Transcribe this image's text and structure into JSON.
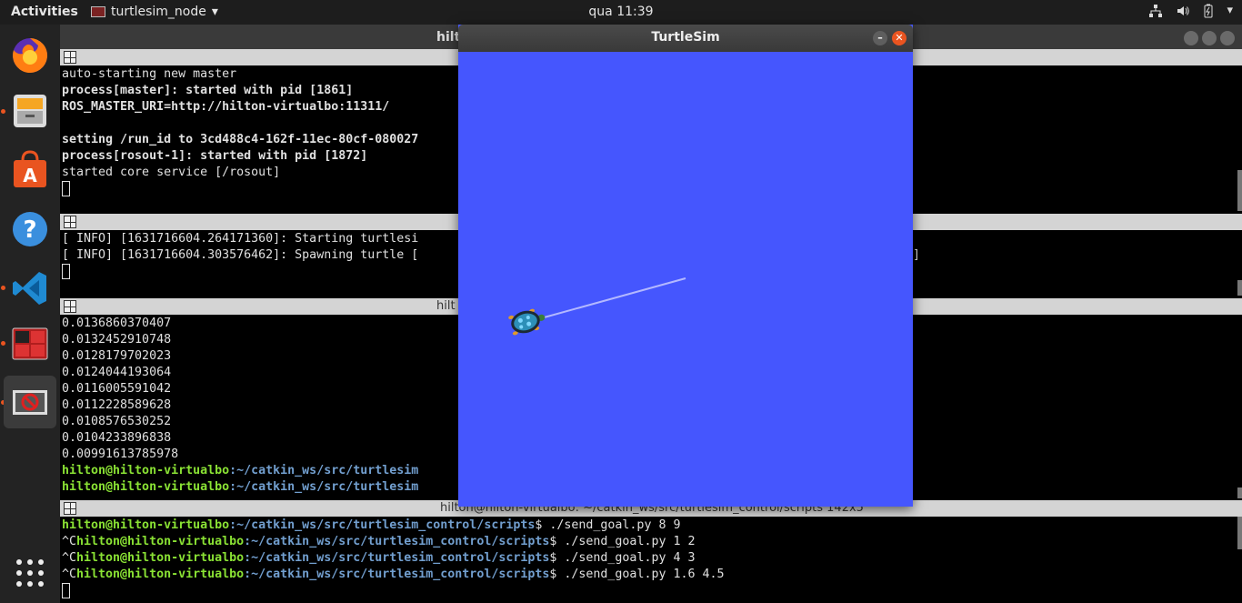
{
  "topbar": {
    "activities": "Activities",
    "app_name": "turtlesim_node",
    "clock": "qua 11:39"
  },
  "dock": {
    "items": [
      "firefox-icon",
      "files-icon",
      "software-center-icon",
      "help-icon",
      "vscode-icon",
      "terminator-icon",
      "turtlesim-app-icon",
      "show-applications-icon"
    ]
  },
  "terminal": {
    "window_title": "hilt",
    "pane1": {
      "lines": [
        "auto-starting new master",
        "process[master]: started with pid [1861]",
        "ROS_MASTER_URI=http://hilton-virtualbo:11311/",
        "",
        "setting /run_id to 3cd488c4-162f-11ec-80cf-080027",
        "process[rosout-1]: started with pid [1872]",
        "started core service [/rosout]"
      ]
    },
    "pane2": {
      "lines": [
        "[ INFO] [1631716604.264171360]: Starting turtlesi",
        "[ INFO] [1631716604.303576462]: Spawning turtle ["
      ],
      "trailing": "]"
    },
    "pane3": {
      "title": "hilt",
      "values": [
        "0.0136860370407",
        "0.0132452910748",
        "0.0128179702023",
        "0.0124044193064",
        "0.0116005591042",
        "0.0112228589628",
        "0.0108576530252",
        "0.0104233896838",
        "0.00991613785978"
      ],
      "prompt_user": "hilton@hilton-virtualbo",
      "prompt_path": ":~/catkin_ws/src/turtlesim",
      "prompt_path_2": ":~/catkin_ws/src/turtlesim"
    },
    "pane4": {
      "title": "hilton@hilton-virtualbo: ~/catkin_ws/src/turtlesim_control/scripts 142x5",
      "commands": [
        {
          "prefix": "",
          "user": "hilton@hilton-virtualbo",
          "path": ":~/catkin_ws/src/turtlesim_control/scripts",
          "cmd": "$ ./send_goal.py 8 9"
        },
        {
          "prefix": "^C",
          "user": "hilton@hilton-virtualbo",
          "path": ":~/catkin_ws/src/turtlesim_control/scripts",
          "cmd": "$ ./send_goal.py 1 2"
        },
        {
          "prefix": "^C",
          "user": "hilton@hilton-virtualbo",
          "path": ":~/catkin_ws/src/turtlesim_control/scripts",
          "cmd": "$ ./send_goal.py 4 3"
        },
        {
          "prefix": "^C",
          "user": "hilton@hilton-virtualbo",
          "path": ":~/catkin_ws/src/turtlesim_control/scripts",
          "cmd": "$ ./send_goal.py 1.6 4.5"
        }
      ]
    }
  },
  "turtlesim": {
    "title": "TurtleSim",
    "background_color": "#4556fe",
    "pen_color": "#b3b8ff"
  }
}
